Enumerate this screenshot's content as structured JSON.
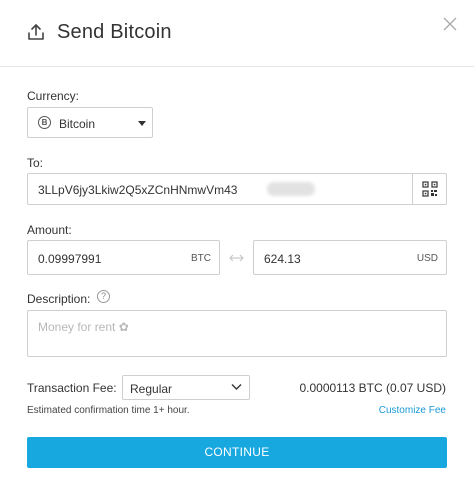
{
  "header": {
    "title": "Send Bitcoin"
  },
  "currency": {
    "label": "Currency:",
    "selected": "Bitcoin",
    "icon_glyph": "B"
  },
  "to": {
    "label": "To:",
    "address": "3LLpV6jy3Lkiw2Q5xZCnHNmwVm43"
  },
  "amount": {
    "label": "Amount:",
    "btc_value": "0.09997991",
    "btc_unit": "BTC",
    "usd_value": "624.13",
    "usd_unit": "USD"
  },
  "description": {
    "label": "Description:",
    "help_glyph": "?",
    "placeholder": "Money for rent ✿"
  },
  "fee": {
    "label": "Transaction Fee:",
    "selected": "Regular",
    "amount": "0.0000113 BTC (0.07 USD)",
    "confirmation": "Estimated confirmation time 1+ hour.",
    "customize_link": "Customize Fee"
  },
  "continue_label": "CONTINUE",
  "colors": {
    "accent": "#18a8e0",
    "link": "#1a9ad6",
    "border": "#cfcfcf"
  }
}
